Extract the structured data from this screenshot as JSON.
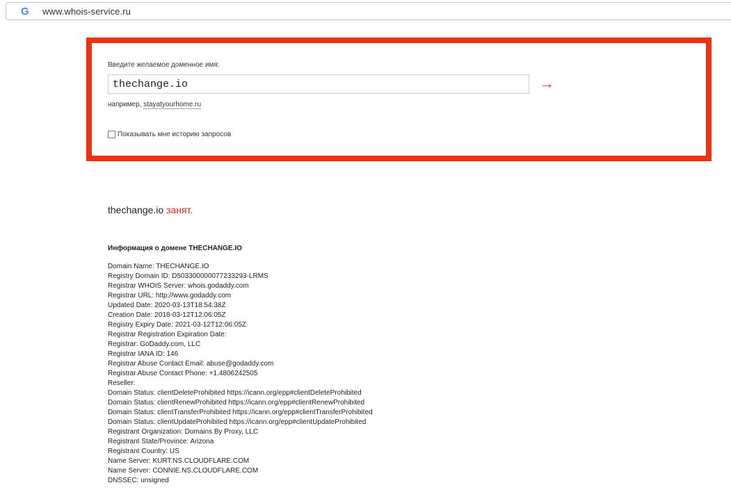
{
  "browser": {
    "url": "www.whois-service.ru"
  },
  "search": {
    "prompt": "Введите желаемое доменное имя:",
    "value": "thechange.io",
    "submit_glyph": "→",
    "example_prefix": "например,",
    "example_link": "stayatyourhome.ru",
    "history_label": "Показывать мне историю запросов",
    "history_checked": false
  },
  "result": {
    "domain": "thechange.io",
    "status": "занят."
  },
  "info": {
    "title": "Информация о домене THECHANGE.IO",
    "lines": [
      "Domain Name: THECHANGE.IO",
      "Registry Domain ID: D503300000077233293-LRMS",
      "Registrar WHOIS Server: whois.godaddy.com",
      "Registrar URL: http://www.godaddy.com",
      "Updated Date: 2020-03-13T18:54:38Z",
      "Creation Date: 2018-03-12T12:06:05Z",
      "Registry Expiry Date: 2021-03-12T12:06:05Z",
      "Registrar Registration Expiration Date:",
      "Registrar: GoDaddy.com, LLC",
      "Registrar IANA ID: 146",
      "Registrar Abuse Contact Email: abuse@godaddy.com",
      "Registrar Abuse Contact Phone: +1.4806242505",
      "Reseller:",
      "Domain Status: clientDeleteProhibited https://icann.org/epp#clientDeleteProhibited",
      "Domain Status: clientRenewProhibited https://icann.org/epp#clientRenewProhibited",
      "Domain Status: clientTransferProhibited https://icann.org/epp#clientTransferProhibited",
      "Domain Status: clientUpdateProhibited https://icann.org/epp#clientUpdateProhibited",
      "Registrant Organization: Domains By Proxy, LLC",
      "Registrant State/Province: Arizona",
      "Registrant Country: US",
      "Name Server: KURT.NS.CLOUDFLARE.COM",
      "Name Server: CONNIE.NS.CLOUDFLARE.COM",
      "DNSSEC: unsigned"
    ]
  },
  "colors": {
    "highlight_border": "#f0300f",
    "status_red": "#d2281e",
    "arrow_red": "#e8402a"
  }
}
